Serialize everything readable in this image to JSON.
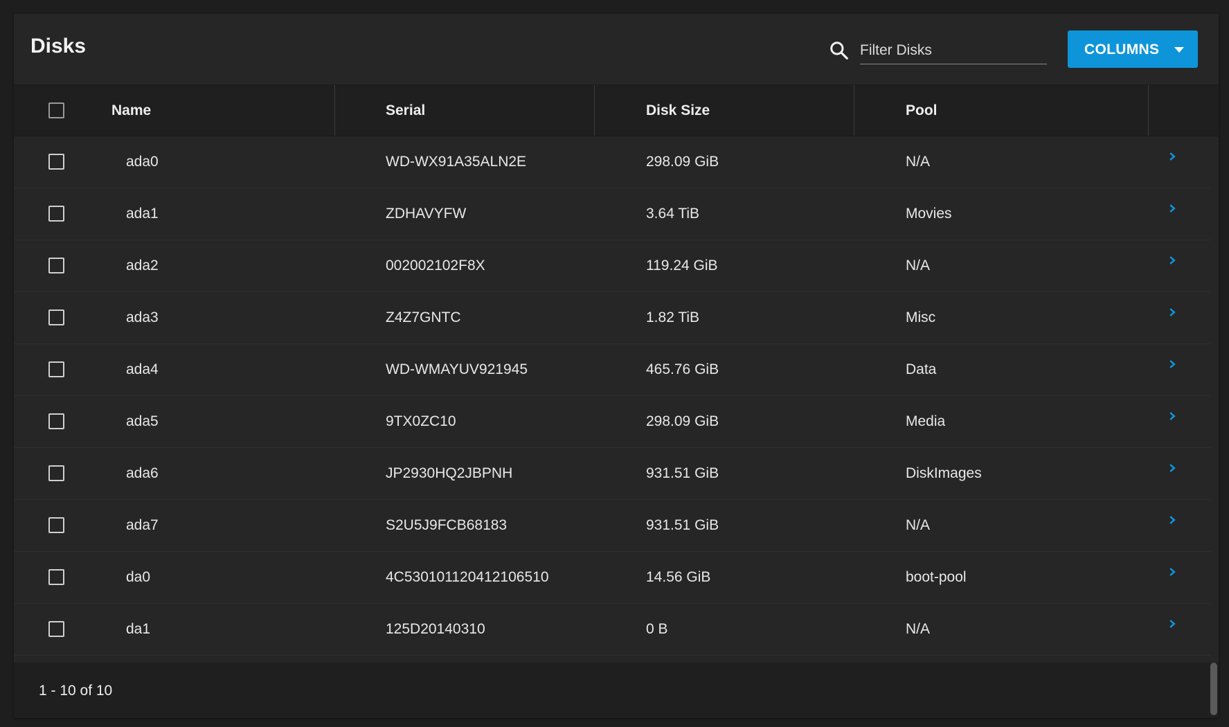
{
  "header": {
    "title": "Disks",
    "filter_placeholder": "Filter Disks",
    "filter_value": "",
    "columns_button": "COLUMNS"
  },
  "table": {
    "columns": [
      "Name",
      "Serial",
      "Disk Size",
      "Pool"
    ],
    "rows": [
      {
        "name": "ada0",
        "serial": "WD-WX91A35ALN2E",
        "size": "298.09 GiB",
        "pool": "N/A"
      },
      {
        "name": "ada1",
        "serial": "ZDHAVYFW",
        "size": "3.64 TiB",
        "pool": "Movies"
      },
      {
        "name": "ada2",
        "serial": "002002102F8X",
        "size": "119.24 GiB",
        "pool": "N/A"
      },
      {
        "name": "ada3",
        "serial": "Z4Z7GNTC",
        "size": "1.82 TiB",
        "pool": "Misc"
      },
      {
        "name": "ada4",
        "serial": "WD-WMAYUV921945",
        "size": "465.76 GiB",
        "pool": "Data"
      },
      {
        "name": "ada5",
        "serial": "9TX0ZC10",
        "size": "298.09 GiB",
        "pool": "Media"
      },
      {
        "name": "ada6",
        "serial": "JP2930HQ2JBPNH",
        "size": "931.51 GiB",
        "pool": "DiskImages"
      },
      {
        "name": "ada7",
        "serial": "S2U5J9FCB68183",
        "size": "931.51 GiB",
        "pool": "N/A"
      },
      {
        "name": "da0",
        "serial": "4C530101120412106510",
        "size": "14.56 GiB",
        "pool": "boot-pool"
      },
      {
        "name": "da1",
        "serial": "125D20140310",
        "size": "0 B",
        "pool": "N/A"
      }
    ]
  },
  "footer": {
    "pagination": "1 - 10 of 10"
  },
  "colors": {
    "accent": "#0e95d9",
    "background": "#1e1e1e",
    "card": "#262626"
  },
  "icons": {
    "search": "search-icon",
    "expand": "chevron-right-icon",
    "dropdown": "caret-down-icon"
  }
}
